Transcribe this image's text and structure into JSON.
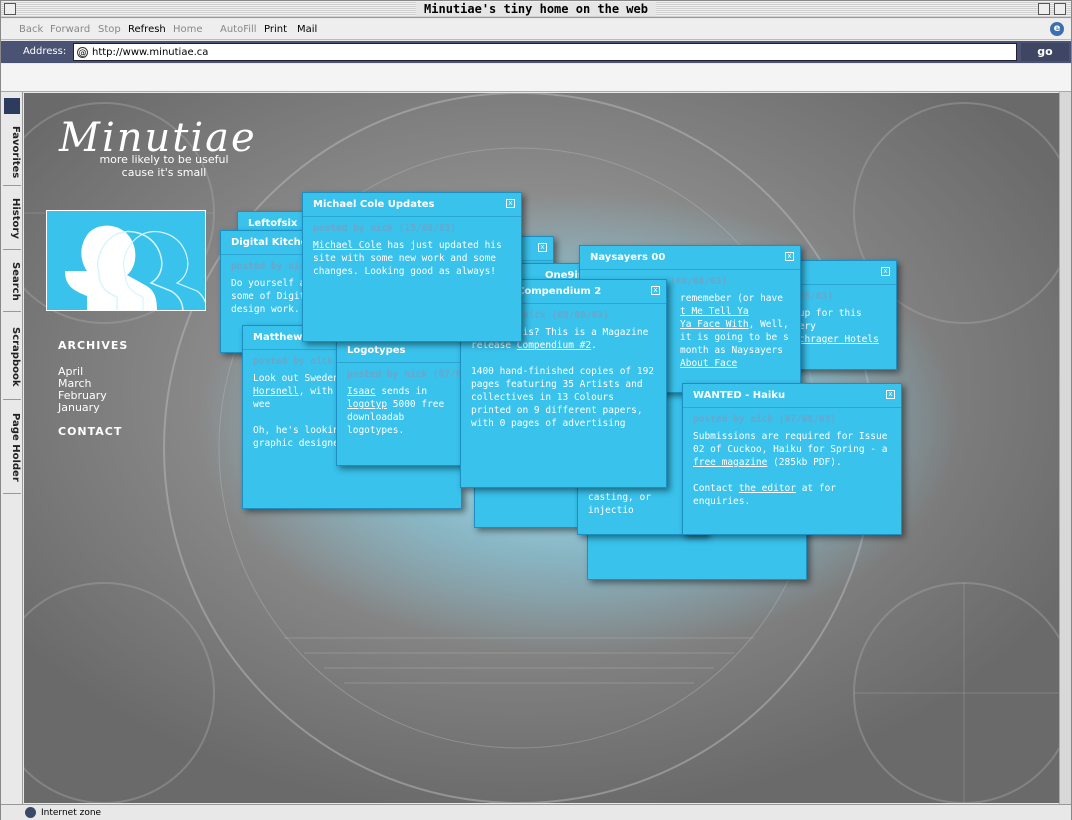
{
  "window": {
    "title": "Minutiae's tiny home on the web"
  },
  "toolbar": {
    "back": "Back",
    "forward": "Forward",
    "stop": "Stop",
    "refresh": "Refresh",
    "home": "Home",
    "autofill": "AutoFill",
    "print": "Print",
    "mail": "Mail"
  },
  "address": {
    "label": "Address:",
    "url": "http://www.minutiae.ca",
    "go": "go"
  },
  "sidebar": {
    "tabs": [
      "Favorites",
      "History",
      "Search",
      "Scrapbook",
      "Page Holder"
    ]
  },
  "status": {
    "zone": "Internet zone"
  },
  "site": {
    "logo": "Minutiae",
    "tagline1": "more likely to be useful",
    "tagline2": "cause it's small",
    "archives_heading": "ARCHIVES",
    "archives": [
      "April",
      "March",
      "February",
      "January"
    ],
    "contact": "CONTACT"
  },
  "popups": {
    "leftofsix": {
      "title": "Leftofsix"
    },
    "digital": {
      "title": "Digital Kitchen",
      "meta": "posted by nick",
      "body": "Do yourself a some of Digita design work."
    },
    "michael": {
      "title": "Michael Cole Updates",
      "meta": "posted by nick (15/08/03)",
      "body_link": "Michael Cole",
      "body": " has just updated his site with some new work and some changes. Looking good as always!"
    },
    "matthew": {
      "title": "Matthew H",
      "meta": "posted by nick (",
      "body_a": "Look out Sweden",
      "body_link": "Horsnell",
      "body_b": ", with a f together this wee",
      "body_c": "Oh, he's looking if you got any co graphic designer them through!"
    },
    "logotypes": {
      "title": "Logotypes",
      "meta": "posted by nick (07/08",
      "body_link": "Isaac",
      "body_a": " sends in ",
      "body_link2": "logotyp",
      "body_b": " 5000 free downloadab logotypes."
    },
    "one9in": {
      "title": "One9in"
    },
    "compendium": {
      "title": "Compendium 2",
      "meta": "nick (08/08/03)",
      "body_a": "What's this? This is a Magazine release ",
      "body_link": "Compendium #2",
      "body_b": "1400 hand-finished copies of 192 pages featuring 35 Artists and collectives in 13 Colours printed on 9 different papers, with 0 pages of advertising"
    },
    "naysayers": {
      "title": "Naysayers 00",
      "meta": "(08/08/03)",
      "body_a": "rememeber (or have",
      "body_link": "t Me Tell Ya",
      "body_link2": "Ya Face   With",
      "body_b": ", Well, it is going to be s month as Naysayers",
      "body_link3": "About Face"
    },
    "schrager": {
      "meta": "(08/03)",
      "body_a": "-up for this very",
      "body_link": "Schrager Hotels"
    },
    "casting": {
      "body": "casting, or injectio"
    },
    "haiku": {
      "title": "WANTED - Haiku",
      "meta": "posted by nick (07/08/03)",
      "body_a": "Submissions are required for Issue 02 of Cuckoo, Haiku for Spring - a ",
      "body_link": "free magazine",
      "body_b": " (285kb PDF).",
      "body_c": "Contact ",
      "body_link2": "the editor",
      "body_d": " at for enquiries."
    }
  },
  "colors": {
    "popup": "#39c2ec",
    "content_bg": "#7a7a7a",
    "address_bar": "#4a5373"
  }
}
